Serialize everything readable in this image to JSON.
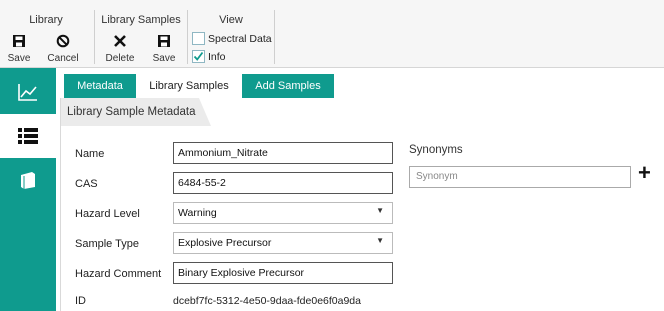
{
  "ribbon": {
    "groups": {
      "library": "Library",
      "library_samples": "Library Samples",
      "view": "View"
    },
    "buttons": {
      "library_save": "Save",
      "library_cancel": "Cancel",
      "samples_delete": "Delete",
      "samples_save": "Save"
    },
    "view_options": {
      "spectral_data": "Spectral Data",
      "spectral_data_checked": false,
      "info": "Info",
      "info_checked": true
    }
  },
  "leftbar": {
    "items": [
      "chart-icon",
      "list-icon",
      "book-icon"
    ],
    "active": "list-icon",
    "accent_color": "#0f9b8e"
  },
  "tabs": [
    {
      "label": "Metadata",
      "active": false
    },
    {
      "label": "Library Samples",
      "active": true
    },
    {
      "label": "Add Samples",
      "active": false
    }
  ],
  "section_title": "Library Sample Metadata",
  "form": {
    "name_label": "Name",
    "name_value": "Ammonium_Nitrate",
    "cas_label": "CAS",
    "cas_value": "6484-55-2",
    "hazard_level_label": "Hazard Level",
    "hazard_level_value": "Warning",
    "sample_type_label": "Sample Type",
    "sample_type_value": "Explosive Precursor",
    "hazard_comment_label": "Hazard Comment",
    "hazard_comment_value": "Binary Explosive Precursor",
    "id_label": "ID",
    "id_value": "dcebf7fc-5312-4e50-9daa-fde0e6f0a9da"
  },
  "synonyms": {
    "title": "Synonyms",
    "placeholder": "Synonym"
  }
}
